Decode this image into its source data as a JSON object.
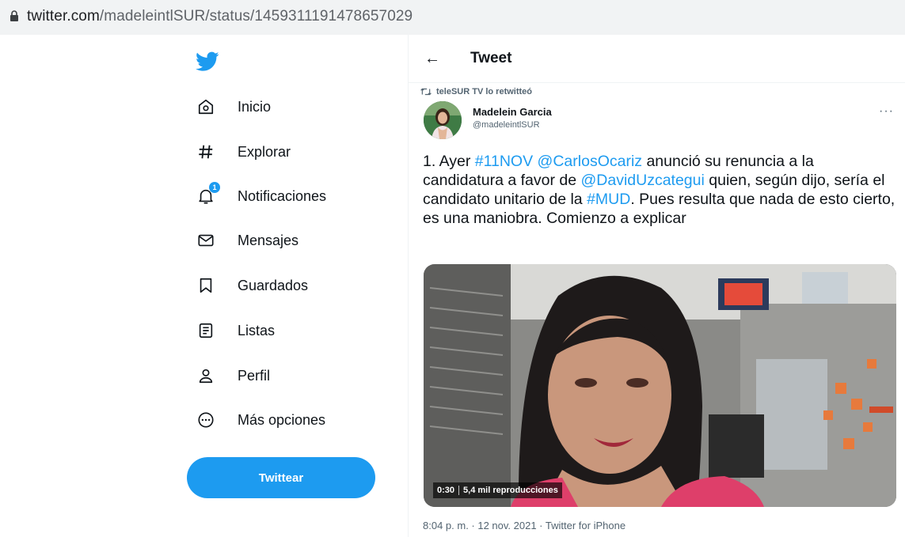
{
  "browser": {
    "url_host": "twitter.com",
    "url_path": "/madeleintlSUR/status/1459311191478657029"
  },
  "sidebar": {
    "logo_icon": "twitter-bird-icon",
    "brand_color": "#1d9bf0",
    "items": [
      {
        "label": "Inicio",
        "icon": "home-icon"
      },
      {
        "label": "Explorar",
        "icon": "hashtag-icon"
      },
      {
        "label": "Notificaciones",
        "icon": "bell-icon",
        "badge": "1"
      },
      {
        "label": "Mensajes",
        "icon": "envelope-icon"
      },
      {
        "label": "Guardados",
        "icon": "bookmark-icon"
      },
      {
        "label": "Listas",
        "icon": "list-icon"
      },
      {
        "label": "Perfil",
        "icon": "person-icon"
      },
      {
        "label": "Más opciones",
        "icon": "more-circle-icon"
      }
    ],
    "tweet_button": "Twittear"
  },
  "header": {
    "back_icon": "←",
    "title": "Tweet"
  },
  "tweet": {
    "retweeted_by": "teleSUR TV lo retwitteó",
    "author_name": "Madelein Garcia",
    "author_handle": "@madeleintlSUR",
    "more_label": "···",
    "text": {
      "p1": "1. Ayer ",
      "l1": "#11NOV",
      "p2": " ",
      "l2": "@CarlosOcariz",
      "p3": " anunció su renuncia a la candidatura a favor de ",
      "l3": "@DavidUzcategui",
      "p4": " quien, según dijo, sería el candidato unitario de la ",
      "l4": "#MUD",
      "p5": ". Pues resulta que nada de esto cierto, es una maniobra. Comienzo a explicar"
    },
    "video": {
      "duration": "0:30",
      "views": "5,4 mil reproducciones"
    },
    "meta": "8:04 p. m. · 12 nov. 2021 · Twitter for iPhone"
  }
}
